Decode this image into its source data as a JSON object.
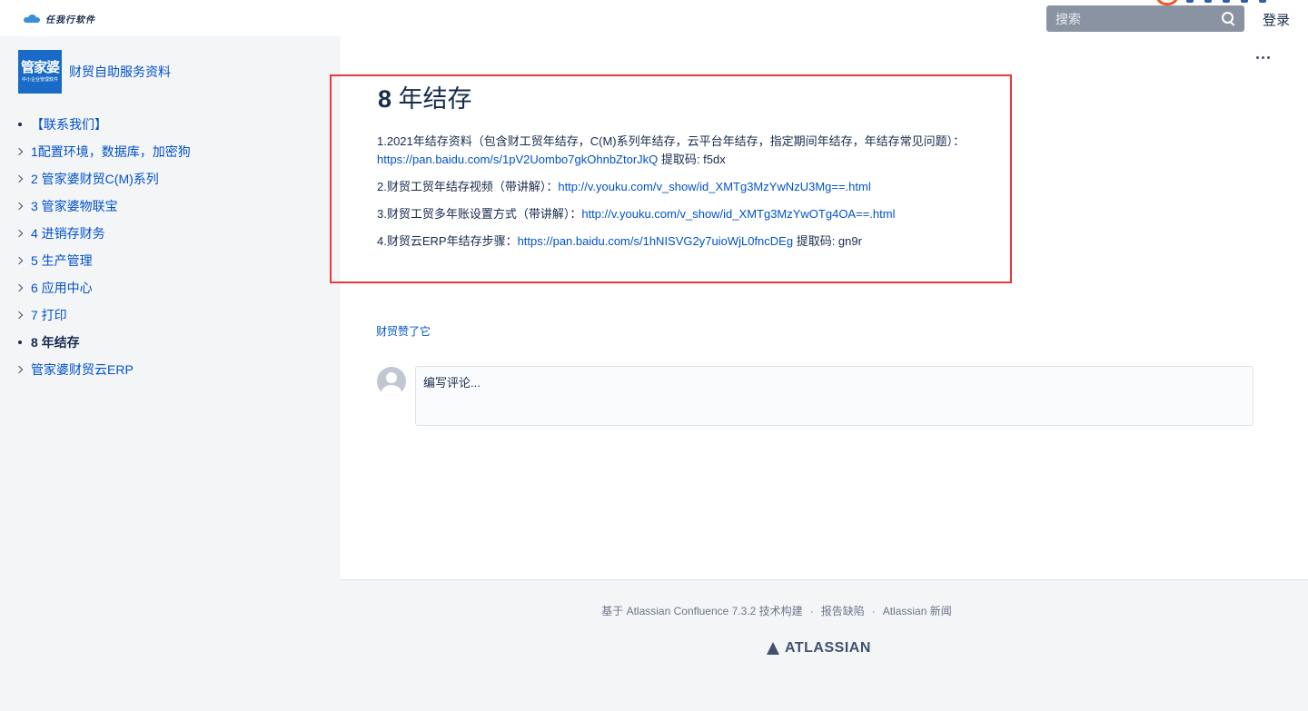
{
  "topbar": {
    "brand": "任我行软件",
    "search_placeholder": "搜索",
    "login": "登录"
  },
  "sidebar": {
    "space_logo_title": "管家婆",
    "space_logo_sub": "中小企业管理软件",
    "space_name": "财贸自助服务资料",
    "items": [
      {
        "label": "【联系我们】",
        "marker": "bullet"
      },
      {
        "label": "1配置环境，数据库，加密狗",
        "marker": "chevron"
      },
      {
        "label": "2 管家婆财贸C(M)系列",
        "marker": "chevron"
      },
      {
        "label": "3 管家婆物联宝",
        "marker": "chevron"
      },
      {
        "label": "4 进销存财务",
        "marker": "chevron"
      },
      {
        "label": "5 生产管理",
        "marker": "chevron"
      },
      {
        "label": "6 应用中心",
        "marker": "chevron"
      },
      {
        "label": "7 打印",
        "marker": "chevron"
      },
      {
        "label": "8 年结存",
        "marker": "bullet",
        "active": true
      },
      {
        "label": "管家婆财贸云ERP",
        "marker": "chevron"
      }
    ]
  },
  "page": {
    "title_num": "8",
    "title_text": " 年结存",
    "p1_text": "1.2021年结存资料（包含财工贸年结存，C(M)系列年结存，云平台年结存，指定期间年结存，年结存常见问题）：",
    "p1_link": "https://pan.baidu.com/s/1pV2Uombo7gkOhnbZtorJkQ",
    "p1_suffix": " 提取码: f5dx",
    "p2_text": "2.财贸工贸年结存视频（带讲解）：",
    "p2_link": "http://v.youku.com/v_show/id_XMTg3MzYwNzU3Mg==.html",
    "p3_text": "3.财贸工贸多年账设置方式（带讲解）：",
    "p3_link": "http://v.youku.com/v_show/id_XMTg3MzYwOTg4OA==.html",
    "p4_text": "4.财贸云ERP年结存步骤：",
    "p4_link": "https://pan.baidu.com/s/1hNISVG2y7uioWjL0fncDEg",
    "p4_suffix": " 提取码: gn9r",
    "likes": "财贸赞了它",
    "comment_placeholder": "编写评论..."
  },
  "footer": {
    "powered_by": "基于 Atlassian Confluence 7.3.2 技术构建",
    "sep": "·",
    "report_bug": "报告缺陷",
    "news": "Atlassian 新闻",
    "logo_text": "ATLASSIAN"
  },
  "colors": {
    "link": "#0052cc",
    "highlight_border": "#e43b3b",
    "search_bg": "#8a93a2"
  }
}
